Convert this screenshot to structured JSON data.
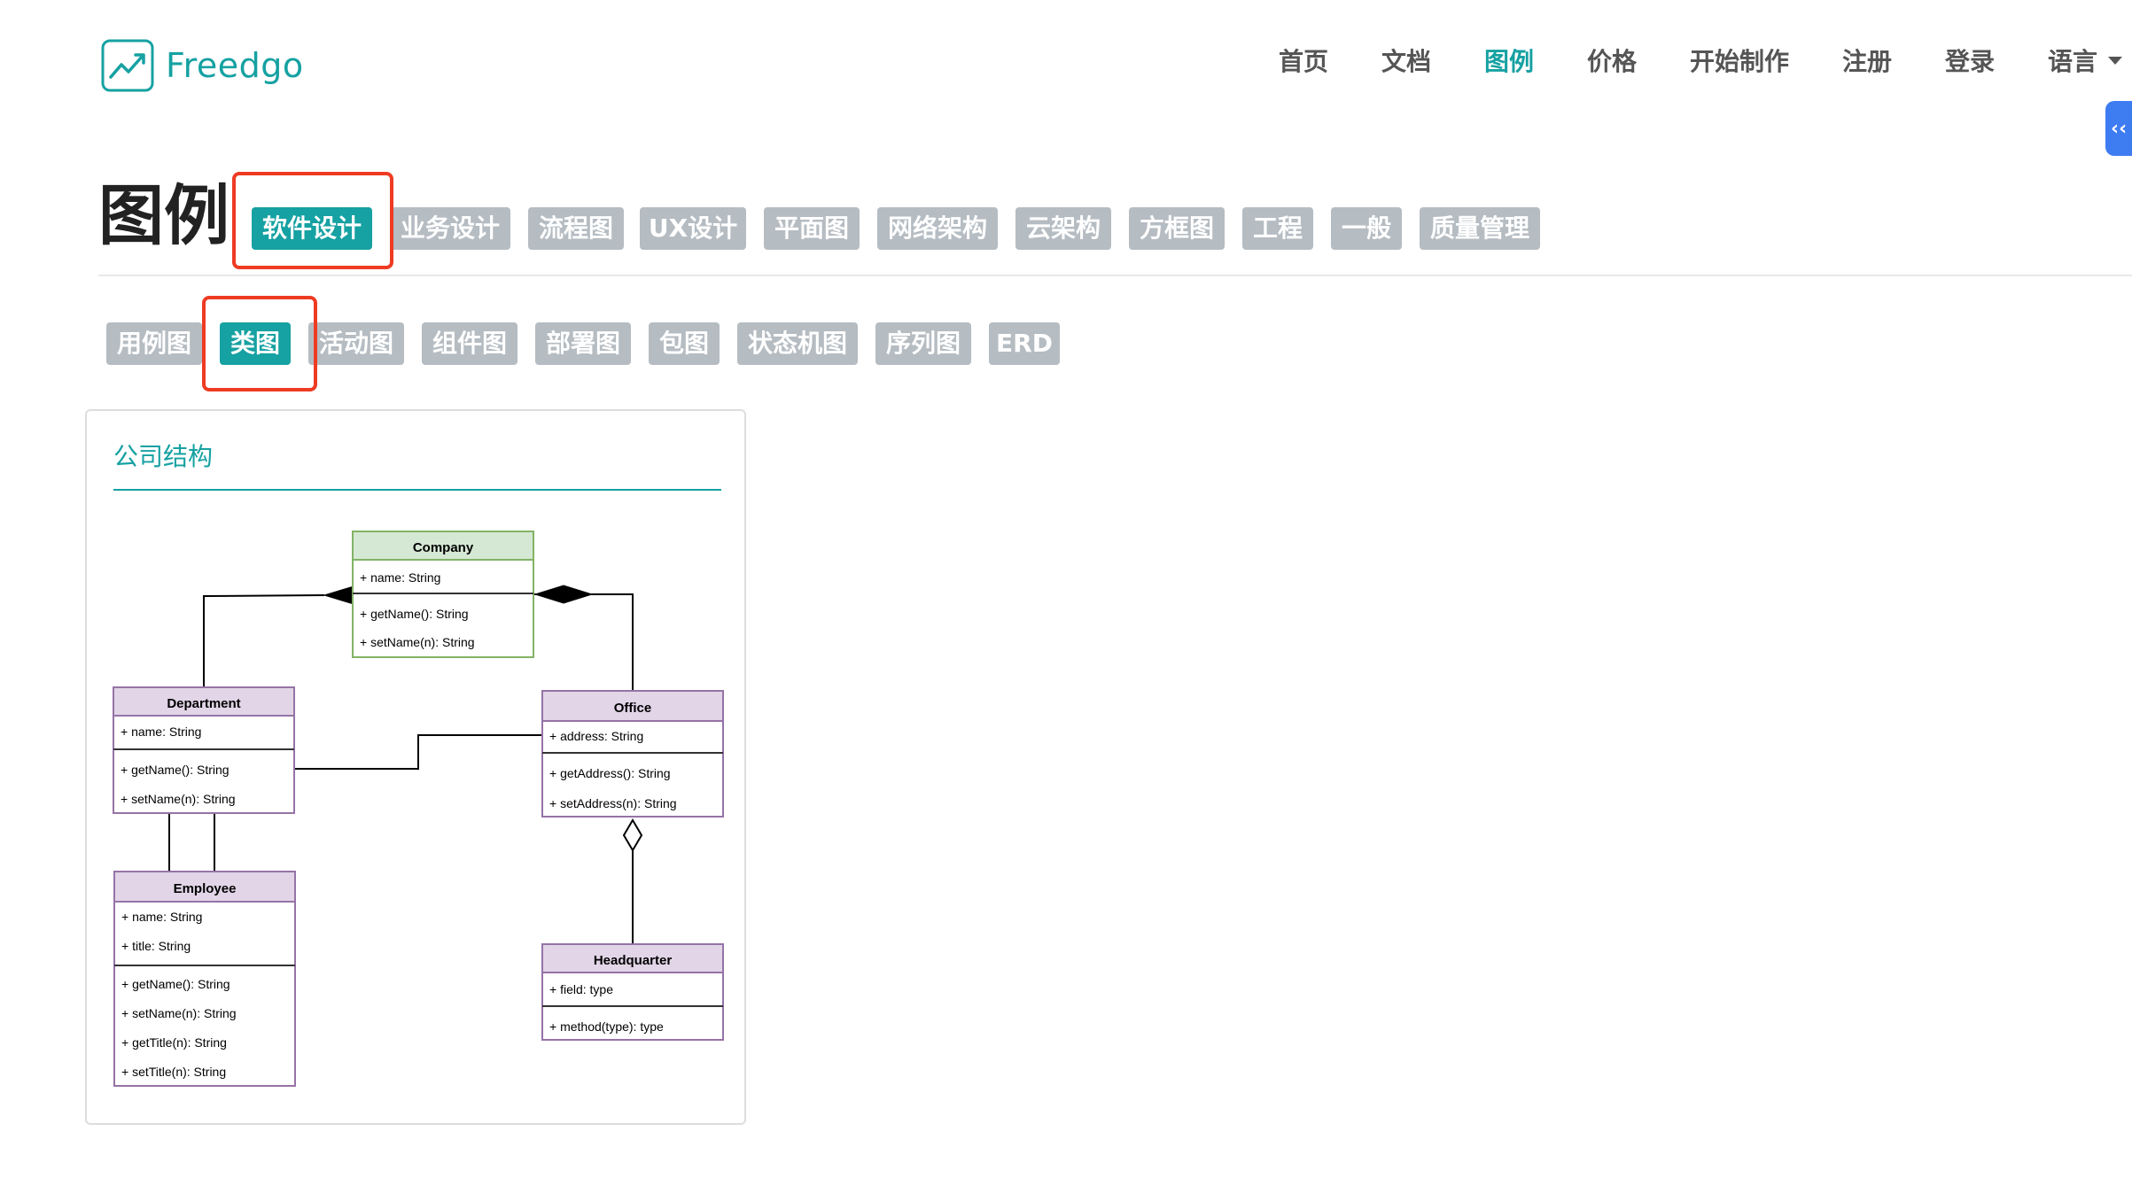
{
  "header": {
    "logo_text": "Freedgo",
    "nav": [
      "首页",
      "文档",
      "图例",
      "价格",
      "开始制作",
      "注册",
      "登录",
      "语言"
    ],
    "active_nav": "图例",
    "side_toggle": "‹‹"
  },
  "page_title": "图例",
  "categories": [
    "软件设计",
    "业务设计",
    "流程图",
    "UX设计",
    "平面图",
    "网络架构",
    "云架构",
    "方框图",
    "工程",
    "一般",
    "质量管理"
  ],
  "active_category": "软件设计",
  "subcategories": [
    "用例图",
    "类图",
    "活动图",
    "组件图",
    "部署图",
    "包图",
    "状态机图",
    "序列图",
    "ERD"
  ],
  "active_subcategory": "类图",
  "card": {
    "title": "公司结构",
    "diagram": {
      "classes": [
        {
          "name": "Company",
          "attributes": [
            "+ name: String"
          ],
          "methods": [
            "+ getName(): String",
            "+ setName(n): String"
          ]
        },
        {
          "name": "Department",
          "attributes": [
            "+ name: String"
          ],
          "methods": [
            "+ getName(): String",
            "+ setName(n): String"
          ]
        },
        {
          "name": "Office",
          "attributes": [
            "+ address: String"
          ],
          "methods": [
            "+ getAddress(): String",
            "+ setAddress(n): String"
          ]
        },
        {
          "name": "Employee",
          "attributes": [
            "+ name: String",
            "+ title: String"
          ],
          "methods": [
            "+ getName(): String",
            "+ setName(n): String",
            "+ getTitle(n): String",
            "+ setTitle(n): String"
          ]
        },
        {
          "name": "Headquarter",
          "attributes": [
            "+ field: type"
          ],
          "methods": [
            "+ method(type): type"
          ]
        }
      ]
    }
  },
  "colors": {
    "accent": "#16a1a2",
    "tab_inactive": "#b5bcc2",
    "highlight": "#ee3b23",
    "company_header": "#d5e8d4",
    "company_border": "#82b366",
    "class_header": "#e1d5e7",
    "class_border": "#9673a6",
    "toggle": "#3e7cf2"
  }
}
